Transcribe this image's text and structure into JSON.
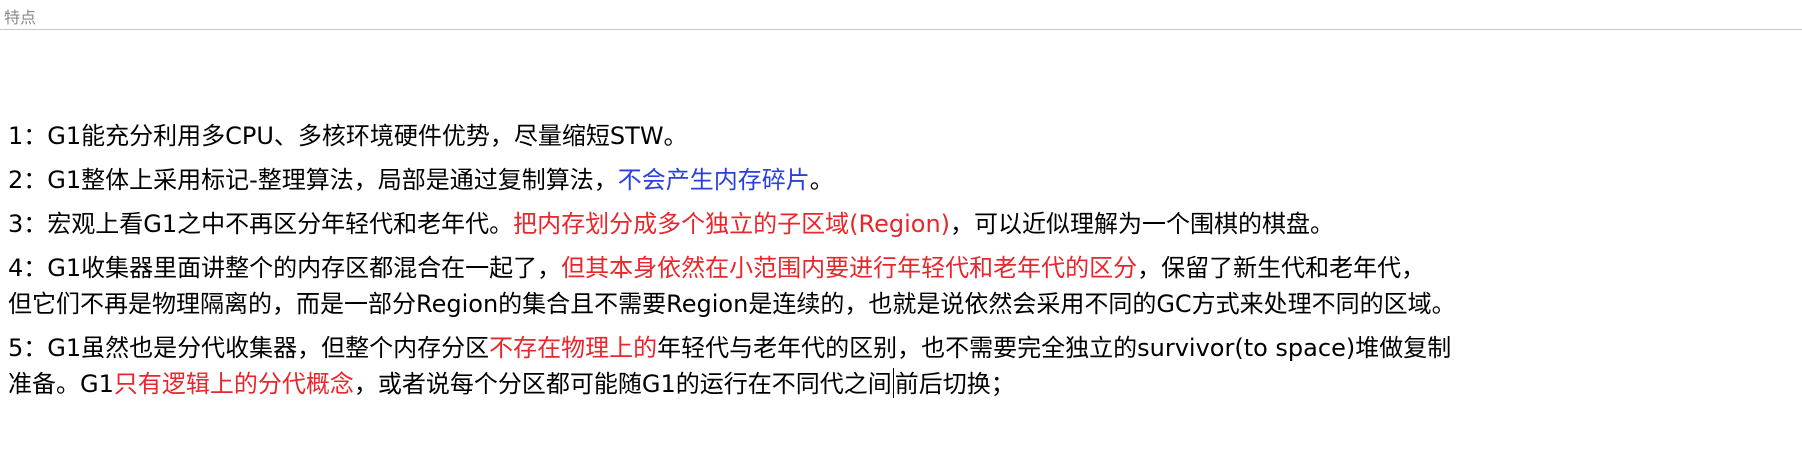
{
  "header": {
    "title": "特点"
  },
  "items": [
    {
      "lines": [
        [
          {
            "text": "1：G1能充分利用多CPU、多核环境硬件优势，尽量缩短STW。",
            "color": "black"
          }
        ]
      ]
    },
    {
      "lines": [
        [
          {
            "text": "2：G1整体上采用标记-整理算法，局部是通过复制算法，",
            "color": "black"
          },
          {
            "text": "不会产生内存碎片",
            "color": "blue"
          },
          {
            "text": "。",
            "color": "black"
          }
        ]
      ]
    },
    {
      "lines": [
        [
          {
            "text": "3：宏观上看G1之中不再区分年轻代和老年代。",
            "color": "black"
          },
          {
            "text": "把内存划分成多个独立的子区域(Region)",
            "color": "red"
          },
          {
            "text": "，可以近似理解为一个围棋的棋盘。",
            "color": "black"
          }
        ]
      ]
    },
    {
      "lines": [
        [
          {
            "text": "4：G1收集器里面讲整个的内存区都混合在一起了，",
            "color": "black"
          },
          {
            "text": "但其本身依然在小范围内要进行年轻代和老年代的区分",
            "color": "red"
          },
          {
            "text": "，保留了新生代和老年代，",
            "color": "black"
          }
        ],
        [
          {
            "text": "但它们不再是物理隔离的，而是一部分Region的集合且不需要Region是连续的，也就是说依然会采用不同的GC方式来处理不同的区域。",
            "color": "black"
          }
        ]
      ]
    },
    {
      "lines": [
        [
          {
            "text": "5：G1虽然也是分代收集器，但整个内存分区",
            "color": "black"
          },
          {
            "text": "不存在物理上的",
            "color": "red"
          },
          {
            "text": "年轻代与老年代的区别，也不需要完全独立的survivor(to space)堆做复制",
            "color": "black"
          }
        ],
        [
          {
            "text": "准备。G1",
            "color": "black"
          },
          {
            "text": "只有逻辑上的分代概念",
            "color": "red"
          },
          {
            "text": "，或者说每个分区都可能随G1的运行在不同代之间",
            "color": "black"
          },
          {
            "caret": true
          },
          {
            "text": "前后切换；",
            "color": "black"
          }
        ]
      ]
    }
  ],
  "colors": {
    "black": "#000000",
    "red": "#e8262b",
    "blue": "#2a3fe0"
  }
}
